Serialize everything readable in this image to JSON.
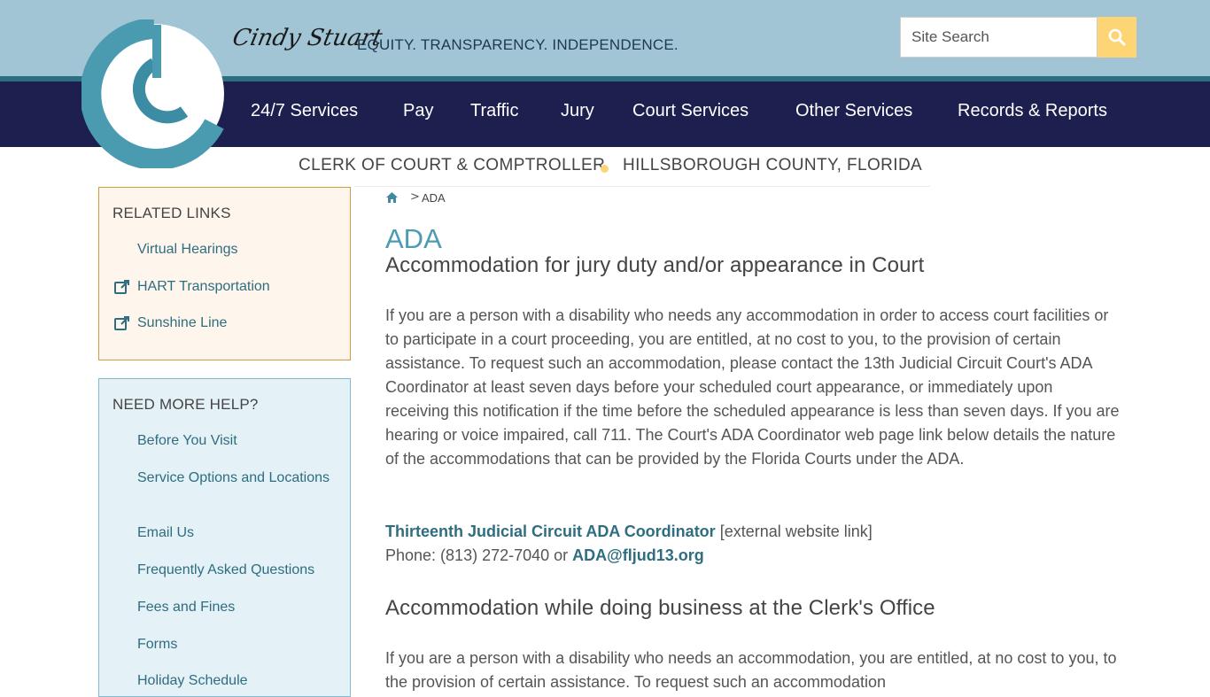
{
  "header": {
    "signature": "Cindy Stuart",
    "tagline": "EQUITY. TRANSPARENCY. INDEPENDENCE.",
    "search_placeholder": "Site Search",
    "search_icon": "search-icon",
    "colors": {
      "top_band": "#a2c5d5",
      "nav_band": "#1d1f4f",
      "accent": "#fdd575",
      "link": "#2f6d80",
      "title": "#4b9bb2"
    }
  },
  "nav": {
    "items": [
      "24/7 Services",
      "Pay",
      "Traffic",
      "Jury",
      "Court Services",
      "Other Services",
      "Records & Reports"
    ]
  },
  "subheader": {
    "left": "CLERK OF COURT & COMPTROLLER",
    "right": "HILLSBOROUGH COUNTY, FLORIDA"
  },
  "related_links": {
    "title": "RELATED LINKS",
    "items": [
      {
        "label": "Virtual Hearings",
        "icon": ""
      },
      {
        "label": "HART Transportation",
        "icon": "external-link-icon"
      },
      {
        "label": "Sunshine Line",
        "icon": "external-link-icon"
      }
    ]
  },
  "need_help": {
    "title": "NEED MORE HELP?",
    "items": [
      "Before You Visit",
      "Service Options and Locations",
      "Email Us",
      "Frequently Asked Questions",
      "Fees and Fines",
      "Forms",
      "Holiday Schedule"
    ]
  },
  "breadcrumb": {
    "home_icon": "home-icon",
    "separator": ">",
    "current": "ADA"
  },
  "content": {
    "title": "ADA",
    "section1_heading": "Accommodation for jury duty and/or appearance in Court",
    "section1_body": "If you are a person with a disability who needs any accommodation in order to access court facilities or to participate in a court proceeding, you are entitled, at no cost to you, to the provision of certain assistance. To request such an accommodation, please contact the 13th Judicial Circuit Court's ADA Coordinator at least seven days before your scheduled court appearance, or immediately upon receiving this notification if the time before the scheduled appearance is less than seven days. If you are hearing or voice impaired, call 711. The Court's ADA Coordinator web page link below details the nature of the accommodations that can be provided by the Florida Courts under the ADA.",
    "coordinator_link": "Thirteenth Judicial Circuit ADA Coordinator",
    "external_note": " [external website link]",
    "phone_prefix": "Phone: (813) 272-7040 or ",
    "email_link": "ADA@fljud13.org",
    "section2_heading": "Accommodation while doing business at the Clerk's Office",
    "section2_body": "If you are a person with a disability who needs an accommodation, you are entitled, at no cost to you, to the provision of certain assistance. To request such an accommodation"
  }
}
